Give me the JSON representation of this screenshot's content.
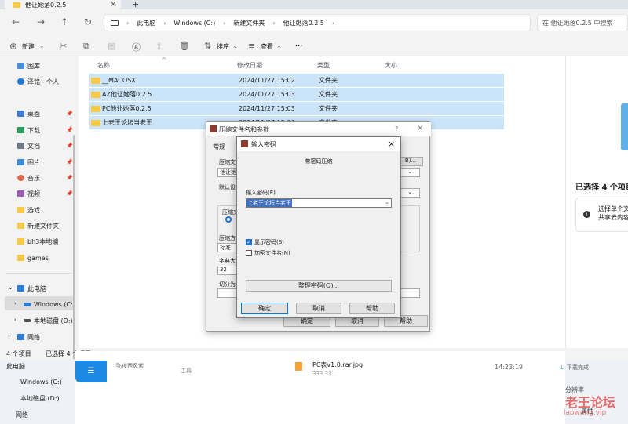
{
  "tab": {
    "title": "他让她落0.2.5",
    "close": "×",
    "new": "+"
  },
  "nav": {
    "back": "←",
    "forward": "→",
    "up": "↑",
    "refresh": "↻"
  },
  "address": {
    "parts": [
      "此电脑",
      "Windows (C:)",
      "新建文件夹",
      "他让她落0.2.5"
    ],
    "search_placeholder": "在 他让她落0.2.5 中搜索"
  },
  "toolbar": {
    "new_label": "新建",
    "sort_label": "排序",
    "view_label": "查看",
    "more_label": "···"
  },
  "sidebar": {
    "items": [
      {
        "label": "图库"
      },
      {
        "label": "泽铭 - 个人"
      },
      {
        "label": "桌面"
      },
      {
        "label": "下载"
      },
      {
        "label": "文档"
      },
      {
        "label": "图片"
      },
      {
        "label": "音乐"
      },
      {
        "label": "视频"
      },
      {
        "label": "游戏"
      },
      {
        "label": "新建文件夹"
      },
      {
        "label": "bh3本地编"
      },
      {
        "label": "games"
      },
      {
        "label": "此电脑"
      },
      {
        "label": "Windows (C:)"
      },
      {
        "label": "本地磁盘 (D:)"
      },
      {
        "label": "网络"
      }
    ]
  },
  "columns": {
    "name": "名称",
    "date": "修改日期",
    "type": "类型",
    "size": "大小"
  },
  "files": [
    {
      "name": "__MACOSX",
      "date": "2024/11/27 15:02",
      "type": "文件夹"
    },
    {
      "name": "AZ他让她落0.2.5",
      "date": "2024/11/27 15:03",
      "type": "文件夹"
    },
    {
      "name": "PC他让她落0.2.5",
      "date": "2024/11/27 15:03",
      "type": "文件夹"
    },
    {
      "name": "上老王论坛当老王",
      "date": "2024/11/27 15:03",
      "type": "文件夹"
    }
  ],
  "status": {
    "count": "4 个项目",
    "selected": "已选择 4 个项目"
  },
  "details": {
    "title": "已选择 4 个项目",
    "note_line1": "选择单个文",
    "note_line2": "共享云内容"
  },
  "dialog_back": {
    "title": "压缩文件名和参数",
    "help": "?",
    "tab_general": "常规",
    "label_file": "压缩文",
    "file_value": "他让她",
    "browse": "B)...",
    "label_default": "默认设",
    "label_format": "压缩文",
    "label_method": "压缩方",
    "method_value": "标准",
    "label_dict": "字典大",
    "dict_value": "32",
    "label_split": "切分为",
    "ok": "确定",
    "cancel": "取消",
    "help_btn": "帮助"
  },
  "dialog_front": {
    "title": "输入密码",
    "subtitle": "带密码压缩",
    "pw_label": "输入密码(E)",
    "pw_value": "上老王论坛当老王",
    "show_pw": "显示密码(S)",
    "encrypt_names": "加密文件名(N)",
    "organize": "整理密码(O)...",
    "ok": "确定",
    "cancel": "取消",
    "help": "帮助"
  },
  "background": {
    "sidebar": [
      "此电脑",
      "Windows (C:)",
      "本地磁盘 (D:)",
      "网络"
    ],
    "file_name": "PC表v1.0.rar.jpg",
    "file_size": "333.33...",
    "time": "14:23:19",
    "download": "下载完成",
    "resolution": "分辨率",
    "props": "属性",
    "tool": "工具",
    "user": "弥夜西风紫"
  },
  "watermark": {
    "text": "老王论坛",
    "url": "laowang.vip"
  }
}
